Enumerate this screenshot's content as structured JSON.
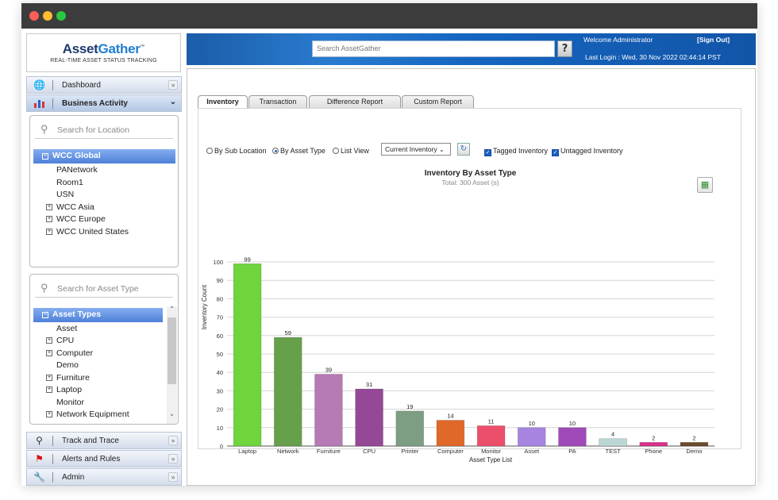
{
  "header": {
    "logo_asset": "Asset",
    "logo_gather": "Gather",
    "logo_tm": "™",
    "tagline": "REAL-TIME ASSET STATUS TRACKING",
    "search_placeholder": "Search AssetGather",
    "help_label": "?",
    "welcome": "Welcome  Administrator",
    "signout": "[Sign Out]",
    "last_login": "Last Login :   Wed, 30 Nov 2022 02:44:14 PST"
  },
  "sidebar": {
    "dashboard": "Dashboard",
    "business_activity": "Business Activity",
    "location_search_placeholder": "Search for Location",
    "location_root": "WCC Global",
    "locations": [
      "PANetwork",
      "Room1",
      "USN",
      "WCC Asia",
      "WCC Europe",
      "WCC United States"
    ],
    "asset_search_placeholder": "Search for Asset Type",
    "asset_root": "Asset Types",
    "asset_types": [
      "Asset",
      "CPU",
      "Computer",
      "Demo",
      "Furniture",
      "Laptop",
      "Monitor",
      "Network Equipment"
    ],
    "track_trace": "Track and Trace",
    "alerts_rules": "Alerts and Rules",
    "admin": "Admin"
  },
  "tabs": [
    "Inventory",
    "Transaction",
    "Difference Report",
    "Custom Report"
  ],
  "options": {
    "by_sub_location": "By Sub Location",
    "by_asset_type": "By Asset Type",
    "list_view": "List View",
    "inventory_select": "Current Inventory",
    "tagged": "Tagged Inventory",
    "untagged": "Untagged Inventory"
  },
  "chart_data": {
    "type": "bar",
    "title": "Inventory By Asset Type",
    "subtitle": "Total: 300 Asset (s)",
    "xlabel": "Asset Type List",
    "ylabel": "Inventory Count",
    "ylim": [
      0,
      100
    ],
    "yticks": [
      0,
      10,
      20,
      30,
      40,
      50,
      60,
      70,
      80,
      90,
      100
    ],
    "grid": true,
    "categories": [
      "Laptop",
      "Network",
      "Furniture",
      "CPU",
      "Printer",
      "Computer",
      "Monitor",
      "Asset",
      "PA",
      "TEST",
      "Phone",
      "Demo"
    ],
    "values": [
      99,
      59,
      39,
      31,
      19,
      14,
      11,
      10,
      10,
      4,
      2,
      2
    ],
    "colors": [
      "#6ed53d",
      "#67a04a",
      "#b67ab5",
      "#944895",
      "#7e9e84",
      "#e0692a",
      "#ec4f6b",
      "#a784e0",
      "#a049b8",
      "#bcd6d6",
      "#da2f8a",
      "#6b4a2a"
    ]
  }
}
